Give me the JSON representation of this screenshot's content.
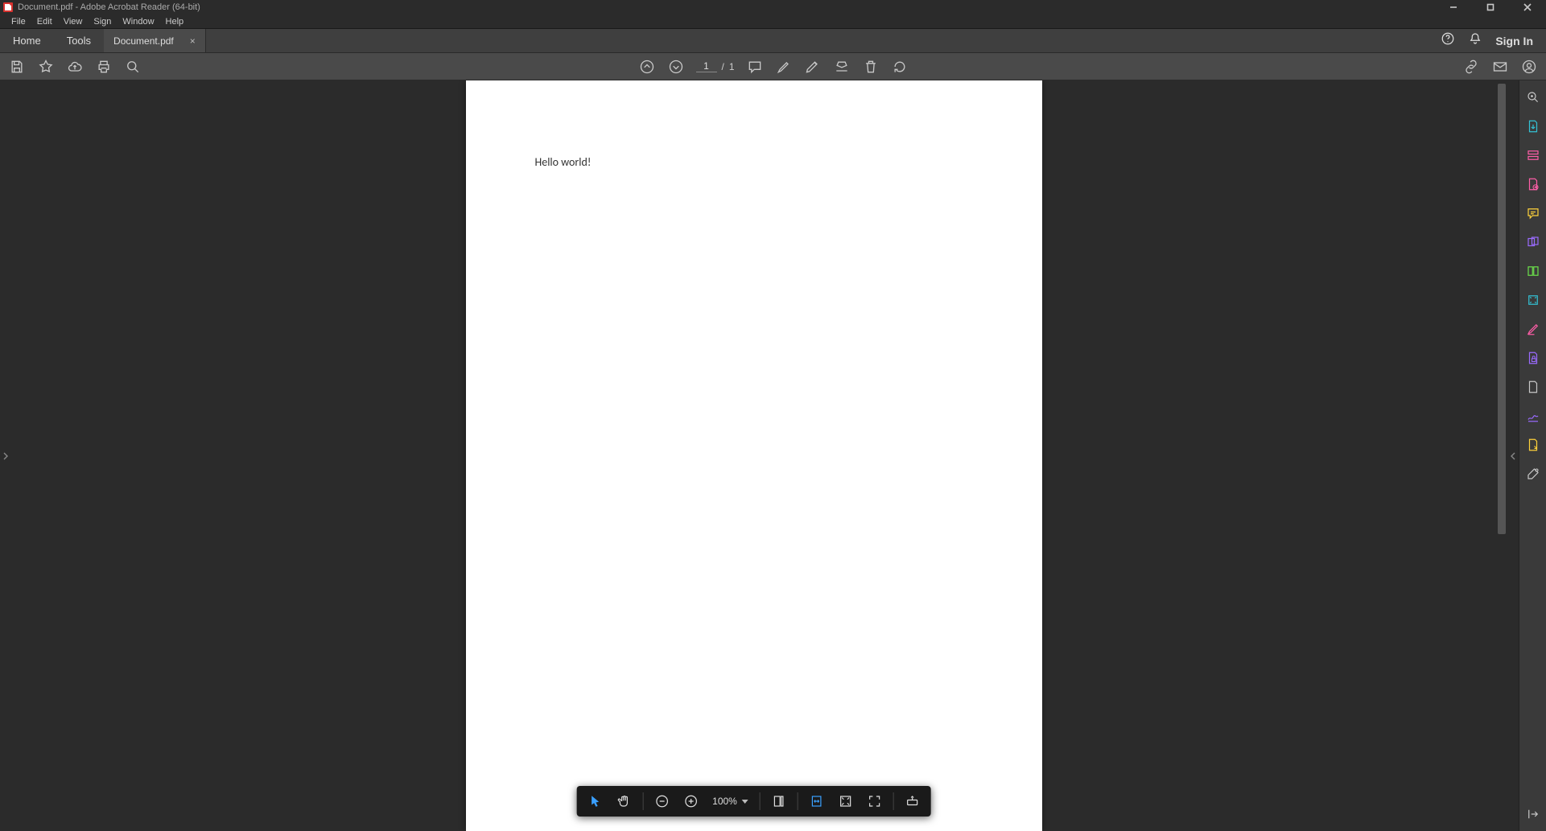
{
  "title": "Document.pdf - Adobe Acrobat Reader (64-bit)",
  "menu": {
    "file": "File",
    "edit": "Edit",
    "view": "View",
    "sign": "Sign",
    "window": "Window",
    "help": "Help"
  },
  "tabs": {
    "home": "Home",
    "tools": "Tools",
    "doc": "Document.pdf"
  },
  "header": {
    "signin": "Sign In"
  },
  "toolbar": {
    "page_current": "1",
    "page_sep": "/",
    "page_total": "1"
  },
  "document": {
    "text": "Hello world!"
  },
  "float": {
    "zoom": "100%"
  }
}
